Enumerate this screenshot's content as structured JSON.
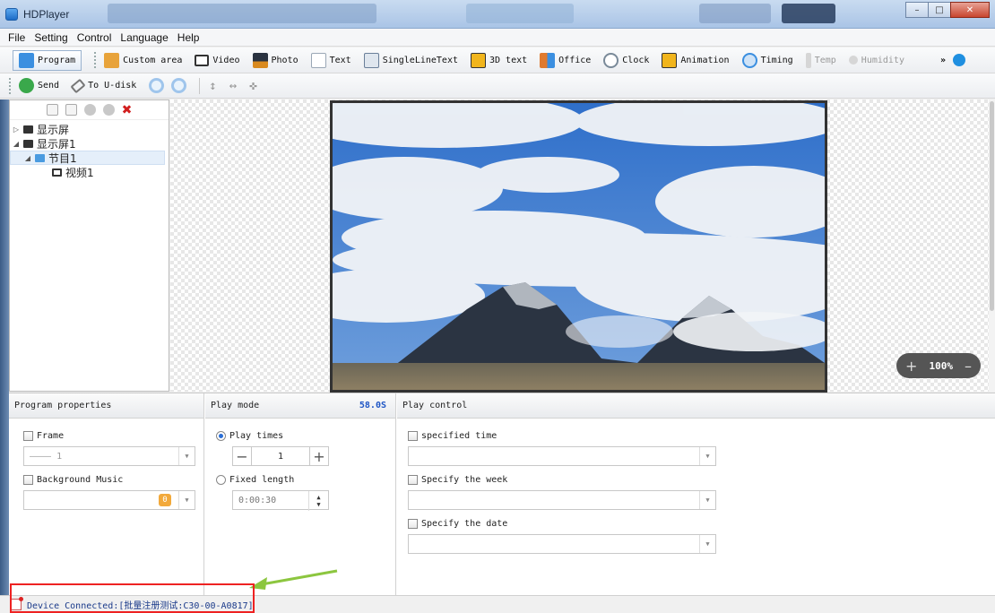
{
  "window": {
    "title": "HDPlayer"
  },
  "menu": [
    "File",
    "Setting",
    "Control",
    "Language",
    "Help"
  ],
  "toolbar1": {
    "items": [
      {
        "label": "Program",
        "icon": "program-icon",
        "color": "#3b8fe0"
      },
      {
        "label": "Custom area",
        "icon": "custom-area-icon",
        "color": "#e8a33a"
      },
      {
        "label": "Video",
        "icon": "video-icon",
        "color": "#333333"
      },
      {
        "label": "Photo",
        "icon": "photo-icon",
        "color": "#d98a1f"
      },
      {
        "label": "Text",
        "icon": "text-icon",
        "color": "#9aa7b5"
      },
      {
        "label": "SingleLineText",
        "icon": "single-line-text-icon",
        "color": "#6a7f99"
      },
      {
        "label": "3D text",
        "icon": "3d-text-icon",
        "color": "#f1b51c"
      },
      {
        "label": "Office",
        "icon": "office-icon",
        "color": "#e07a2e"
      },
      {
        "label": "Clock",
        "icon": "clock-icon",
        "color": "#7a8a99"
      },
      {
        "label": "Animation",
        "icon": "animation-icon",
        "color": "#f1b51c"
      },
      {
        "label": "Timing",
        "icon": "timing-icon",
        "color": "#3b8fe0"
      },
      {
        "label": "Temp",
        "icon": "temperature-icon",
        "color": "#cccccc"
      },
      {
        "label": "Humidity",
        "icon": "humidity-icon",
        "color": "#cccccc"
      }
    ],
    "overflow": "»"
  },
  "toolbar2": {
    "send": "Send",
    "udisk": "To U-disk"
  },
  "tree": {
    "nodes": [
      {
        "label": "显示屏",
        "depth": 0,
        "expanded": false
      },
      {
        "label": "显示屏1",
        "depth": 0,
        "expanded": true
      },
      {
        "label": "节目1",
        "depth": 1,
        "expanded": true,
        "selected": true
      },
      {
        "label": "视频1",
        "depth": 2
      }
    ]
  },
  "zoom": {
    "value": "100%"
  },
  "program_properties": {
    "header": "Program properties",
    "frame_label": "Frame",
    "frame_value": "———— 1",
    "bg_music_label": "Background Music",
    "bg_music_badge": "0"
  },
  "play_mode": {
    "header": "Play mode",
    "duration": "58.0S",
    "play_times_label": "Play times",
    "play_times_value": "1",
    "fixed_length_label": "Fixed length",
    "fixed_length_value": "0:00:30"
  },
  "play_control": {
    "header": "Play control",
    "specified_time": "specified time",
    "specify_week": "Specify the week",
    "specify_date": "Specify the date"
  },
  "status": {
    "text": "Device Connected:[批量注册测试:C30-00-A0817]"
  }
}
